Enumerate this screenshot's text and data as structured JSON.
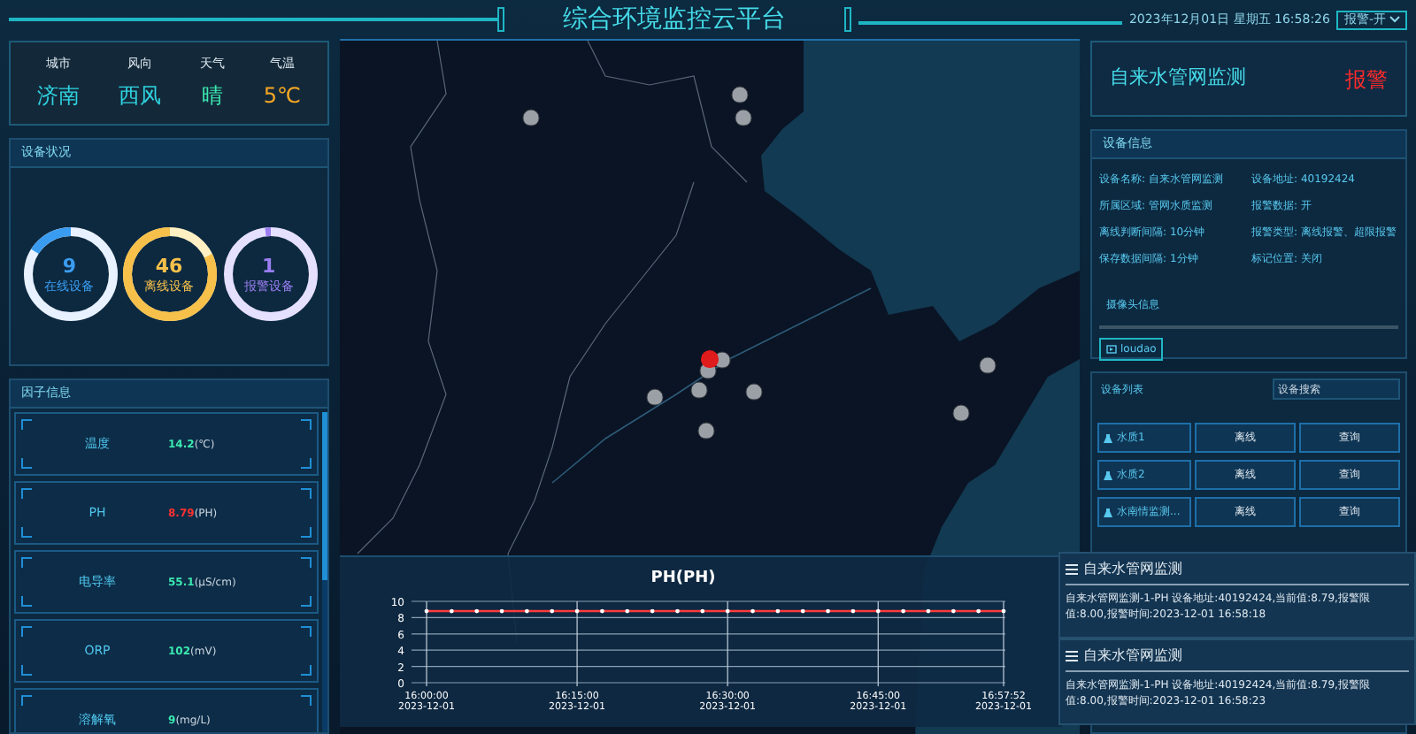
{
  "header": {
    "title": "综合环境监控云平台",
    "datetime": "2023年12月01日 星期五 16:58:26",
    "alarm_select": {
      "value": "报警-开"
    }
  },
  "weather": [
    {
      "label": "城市",
      "value": "济南",
      "color": "#2fd3e0"
    },
    {
      "label": "风向",
      "value": "西风",
      "color": "#2fd3e0"
    },
    {
      "label": "天气",
      "value": "晴",
      "color": "#3be8b0"
    },
    {
      "label": "气温",
      "value": "5℃",
      "color": "#f5a623"
    }
  ],
  "device_status": {
    "title": "设备状况",
    "gauges": [
      {
        "value": "9",
        "label": "在线设备",
        "level": 0.16,
        "color": "#3a9cf0"
      },
      {
        "value": "46",
        "label": "离线设备",
        "level": 0.82,
        "color": "#f7c04a"
      },
      {
        "value": "1",
        "label": "报警设备",
        "level": 0.02,
        "color": "#9a7ef0"
      }
    ]
  },
  "factors": {
    "title": "因子信息",
    "items": [
      {
        "name": "温度",
        "value": "14.2",
        "unit": "(℃)",
        "alarm": false
      },
      {
        "name": "PH",
        "value": "8.79",
        "unit": "(PH)",
        "alarm": true
      },
      {
        "name": "电导率",
        "value": "55.1",
        "unit": "(μS/cm)",
        "alarm": false
      },
      {
        "name": "ORP",
        "value": "102",
        "unit": "(mV)",
        "alarm": false
      },
      {
        "name": "溶解氧",
        "value": "9",
        "unit": "(mg/L)",
        "alarm": false
      }
    ]
  },
  "chart": {
    "chart_data": {
      "type": "line",
      "title": "PH(PH)",
      "categories": [
        "16:00:00 2023-12-01",
        null,
        null,
        null,
        null,
        null,
        "16:15:00 2023-12-01",
        null,
        null,
        null,
        null,
        null,
        "16:30:00 2023-12-01",
        null,
        null,
        null,
        null,
        null,
        "16:45:00 2023-12-01",
        null,
        null,
        null,
        null,
        "16:57:52 2023-12-01"
      ],
      "series": [
        {
          "color": "#ff3b3b",
          "values": [
            8.8,
            8.8,
            8.8,
            8.8,
            8.8,
            8.8,
            8.8,
            8.8,
            8.8,
            8.8,
            8.8,
            8.8,
            8.8,
            8.8,
            8.8,
            8.8,
            8.8,
            8.8,
            8.8,
            8.8,
            8.8,
            8.8,
            8.8,
            8.8
          ]
        }
      ],
      "ylim": [
        0,
        10
      ],
      "yticks": [
        0,
        2,
        4,
        6,
        8,
        10
      ],
      "grid": true
    }
  },
  "alarm_card": {
    "title": "自来水管网监测",
    "status": "报警"
  },
  "device_info": {
    "title": "设备信息",
    "fields": [
      {
        "label": "设备名称:",
        "value": "自来水管网监测"
      },
      {
        "label": "设备地址:",
        "value": "40192424"
      },
      {
        "label": "所属区域:",
        "value": "管网水质监测"
      },
      {
        "label": "报警数据:",
        "value": "开"
      },
      {
        "label": "离线判断间隔:",
        "value": "10分钟"
      },
      {
        "label": "报警类型:",
        "value": "离线报警、超限报警"
      },
      {
        "label": "保存数据间隔:",
        "value": "1分钟"
      },
      {
        "label": "标记位置:",
        "value": "关闭"
      }
    ],
    "camera_title": "摄像头信息",
    "cameras": [
      "loudao"
    ]
  },
  "device_list": {
    "title": "设备列表",
    "search": {
      "placeholder": "设备搜索"
    },
    "rows": [
      {
        "name": "水质1",
        "status": "离线",
        "action": "查询"
      },
      {
        "name": "水质2",
        "status": "离线",
        "action": "查询"
      },
      {
        "name": "水南情监测...",
        "status": "离线",
        "action": "查询"
      }
    ]
  },
  "notifications": [
    {
      "title": "自来水管网监测",
      "message": "自来水管网监测-1-PH 设备地址:40192424,当前值:8.79,报警限值:8.00,报警时间:2023-12-01 16:58:18"
    },
    {
      "title": "自来水管网监测",
      "message": "自来水管网监测-1-PH 设备地址:40192424,当前值:8.79,报警限值:8.00,报警时间:2023-12-01 16:58:23"
    }
  ]
}
